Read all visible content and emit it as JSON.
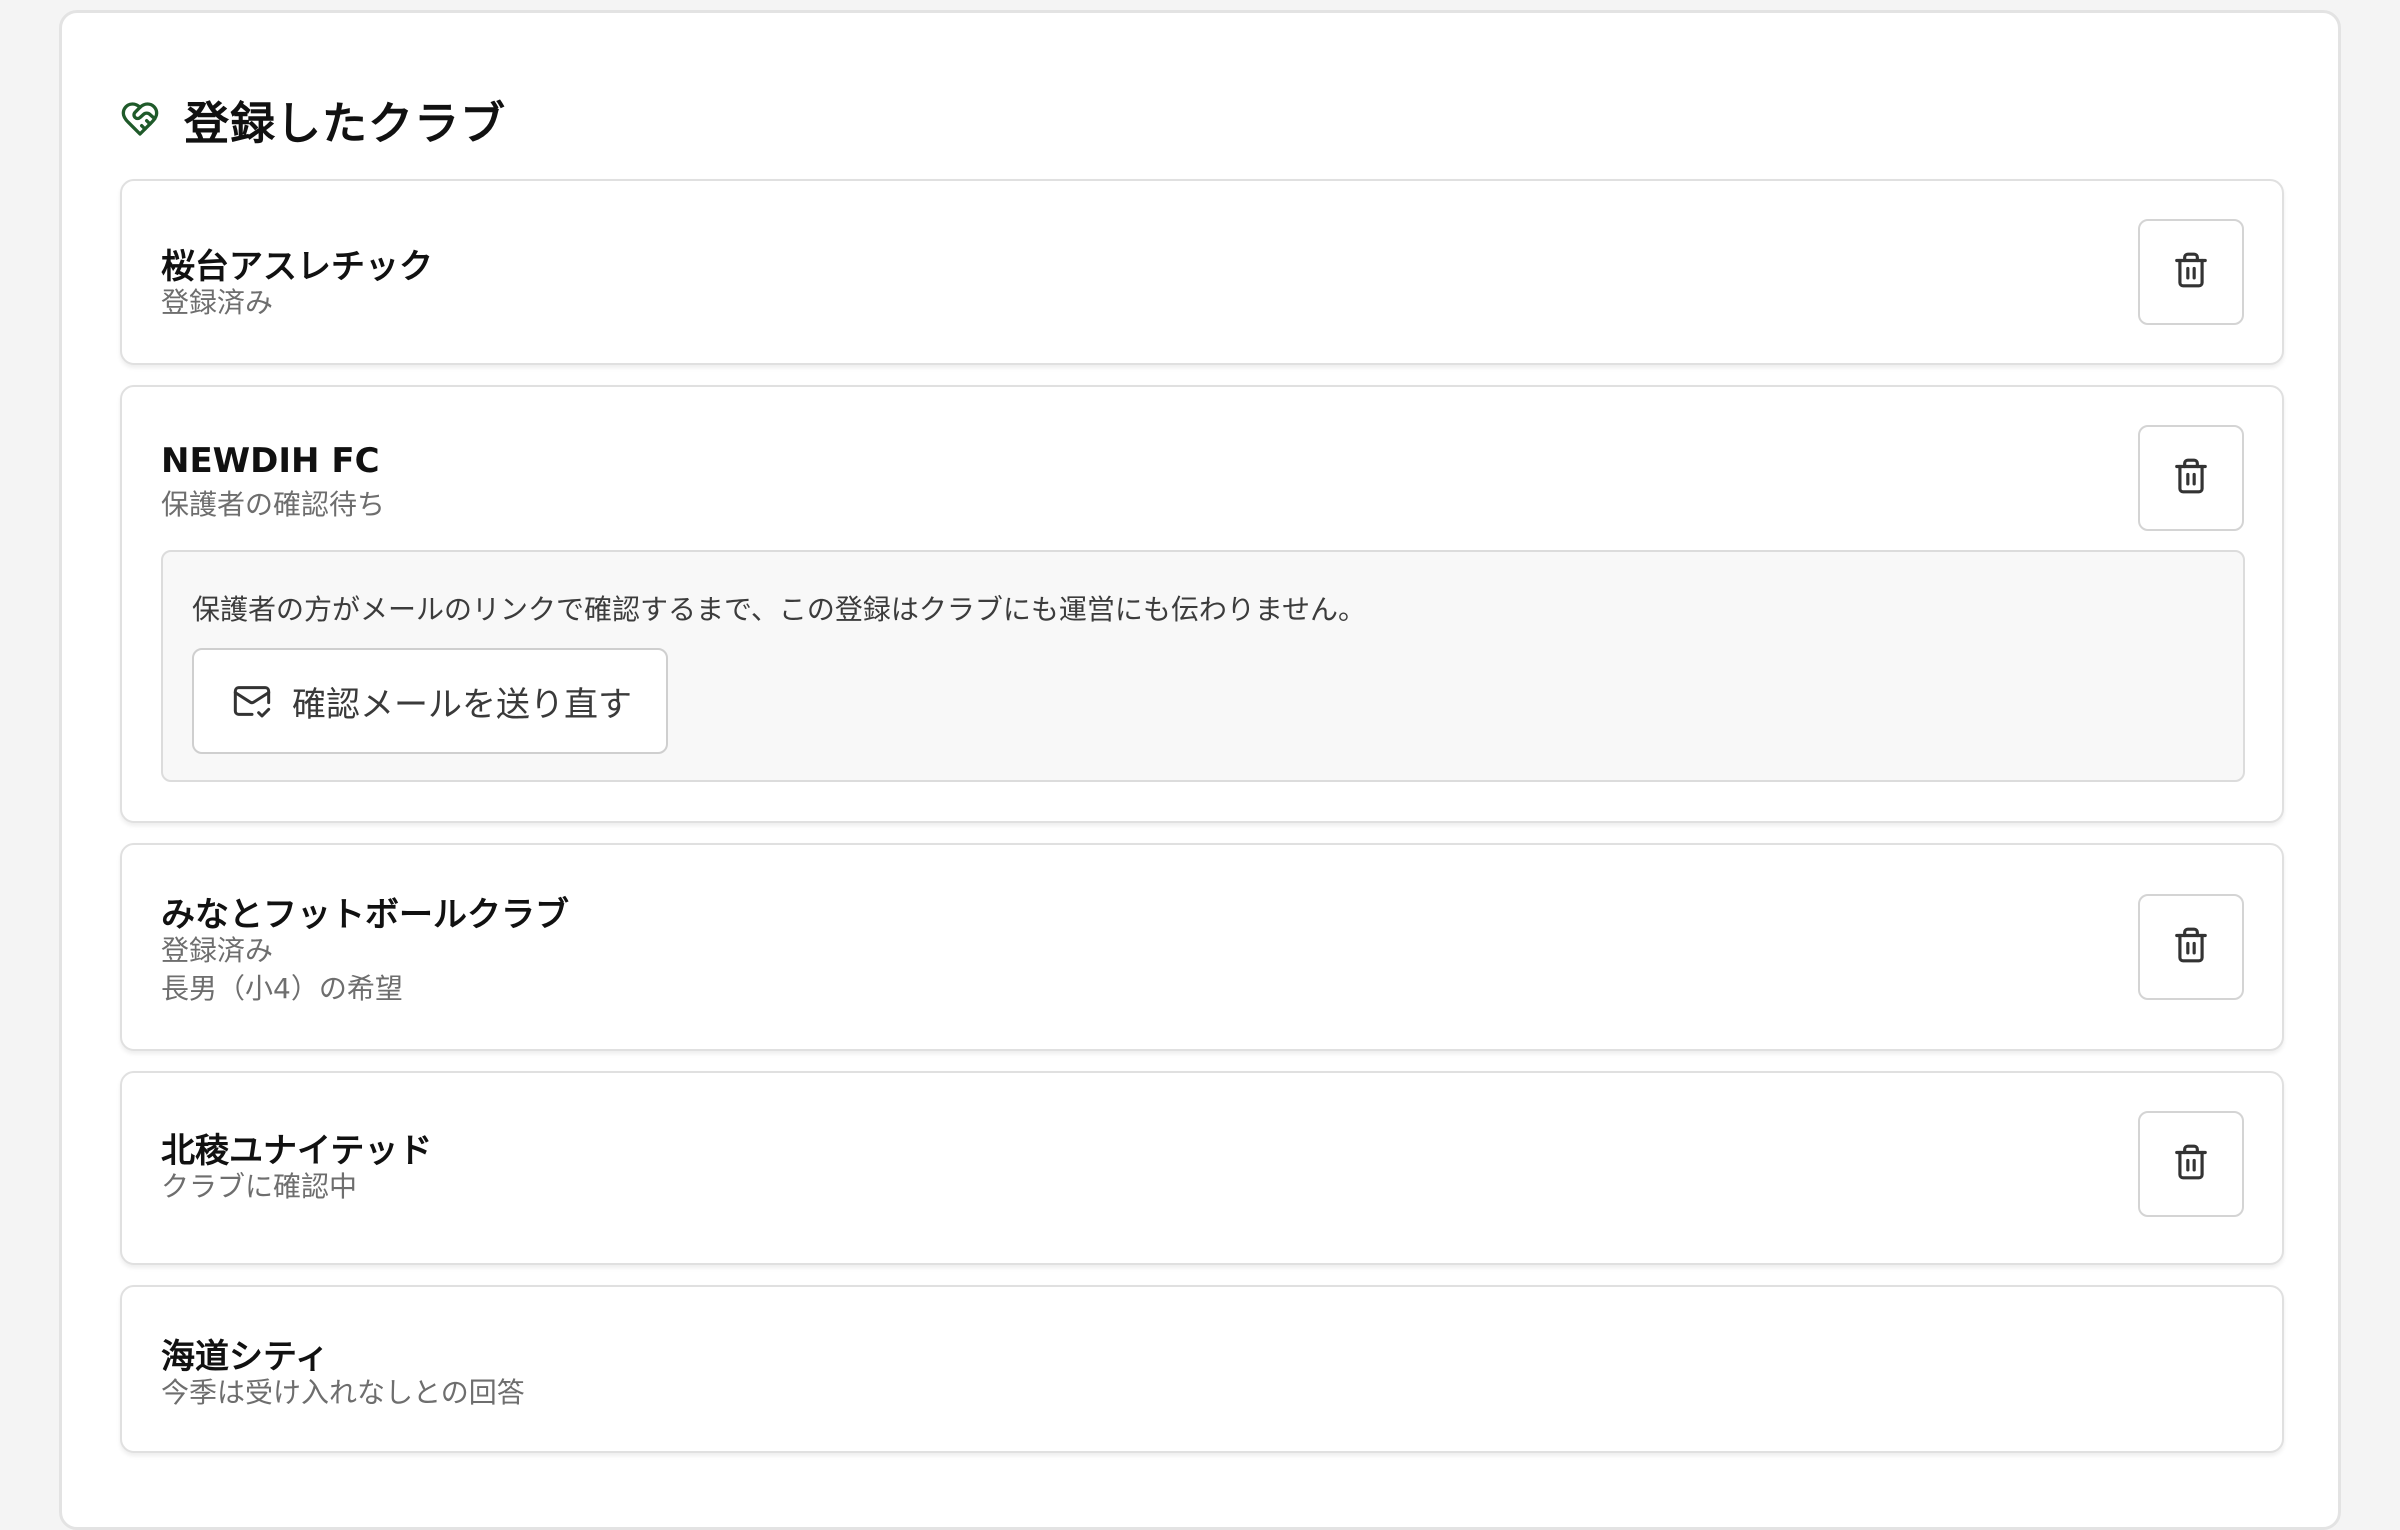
{
  "section": {
    "title": "登録したクラブ",
    "icon": "heart-handshake-icon",
    "accent_color": "#1f5a2a"
  },
  "clubs": [
    {
      "name": "桜台アスレチック",
      "status": "登録済み"
    },
    {
      "name": "NEWDIH FC",
      "status": "保護者の確認待ち",
      "notice": "保護者の方がメールのリンクで確認するまで、この登録はクラブにも運営にも伝わりません。",
      "resend_label": "確認メールを送り直す"
    },
    {
      "name": "みなとフットボールクラブ",
      "status": "登録済み",
      "note": "長男（小4）の希望"
    },
    {
      "name": "北稜ユナイテッド",
      "status": "クラブに確認中"
    },
    {
      "name": "海道シティ",
      "status": "今季は受け入れなしとの回答"
    }
  ]
}
